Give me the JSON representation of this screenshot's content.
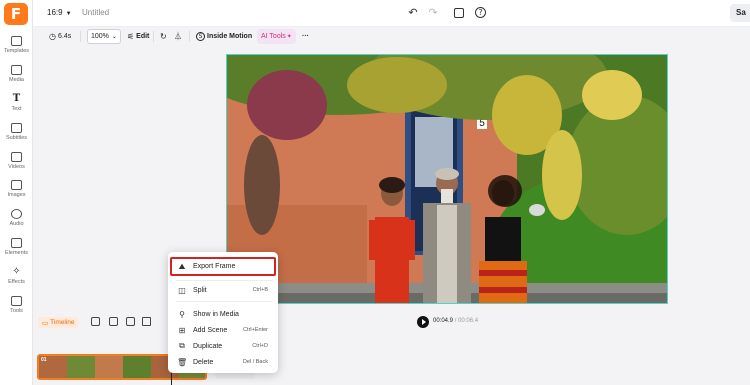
{
  "app": {
    "logo_letter": "F",
    "accent_color": "#ff7a1a"
  },
  "topbar": {
    "ratio_label": "16:9",
    "title": "Untitled",
    "save_label": "Sa"
  },
  "sidebar": {
    "items": [
      {
        "label": "Templates",
        "icon": "templates-icon"
      },
      {
        "label": "Media",
        "icon": "media-icon"
      },
      {
        "label": "Text",
        "icon": "text-icon"
      },
      {
        "label": "Subtitles",
        "icon": "subtitles-icon"
      },
      {
        "label": "Videos",
        "icon": "videos-icon"
      },
      {
        "label": "Images",
        "icon": "images-icon"
      },
      {
        "label": "Audio",
        "icon": "audio-icon"
      },
      {
        "label": "Elements",
        "icon": "elements-icon"
      },
      {
        "label": "Effects",
        "icon": "effects-icon"
      },
      {
        "label": "Tools",
        "icon": "tools-icon"
      }
    ]
  },
  "toolbar": {
    "duration": "6.4s",
    "zoom": "100%",
    "edit_label": "Edit",
    "inside_motion_label": "Inside Motion",
    "ai_tools_label": "AI Tools",
    "more_label": "···"
  },
  "timeline": {
    "label": "Timeline",
    "current_time": "00:04.9",
    "total_time": "/ 00:06.4",
    "clip_number": "01"
  },
  "context_menu": {
    "items": [
      {
        "label": "Export Frame",
        "shortcut": "",
        "icon": "export-frame-icon",
        "highlighted": true
      },
      {
        "label": "Split",
        "shortcut": "Ctrl+B",
        "icon": "split-icon"
      },
      {
        "label": "Show in Media",
        "shortcut": "",
        "icon": "location-pin-icon"
      },
      {
        "label": "Add Scene",
        "shortcut": "Ctrl+Enter",
        "icon": "add-scene-icon"
      },
      {
        "label": "Duplicate",
        "shortcut": "Ctrl+D",
        "icon": "duplicate-icon"
      },
      {
        "label": "Delete",
        "shortcut": "Del / Back",
        "icon": "trash-icon"
      }
    ],
    "highlight_color": "#d62222"
  },
  "canvas": {
    "border_color": "#4fd4c9",
    "house_number": "5"
  }
}
